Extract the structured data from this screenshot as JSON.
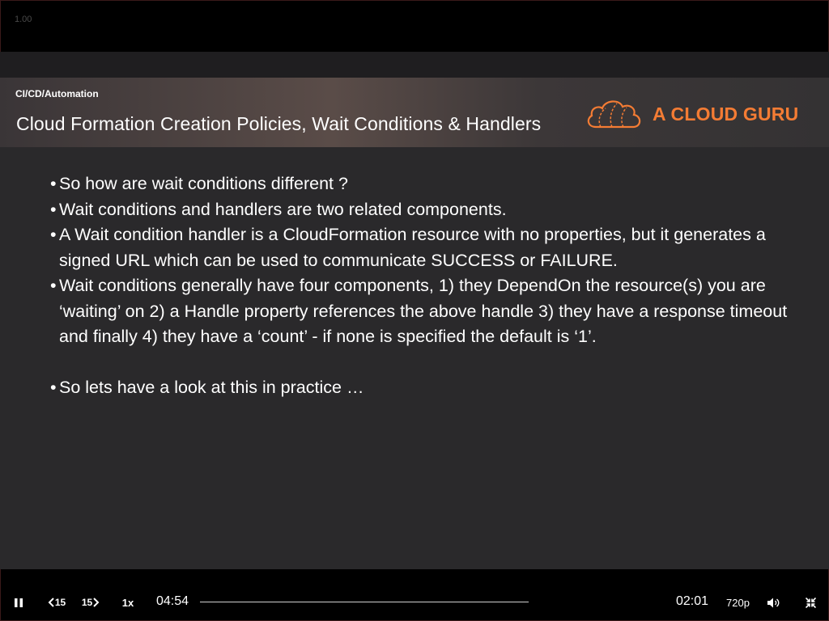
{
  "player": {
    "zoom": "1.00",
    "elapsed": "04:54",
    "remaining": "02:01",
    "speed": "1x",
    "rewind_label": "15",
    "forward_label": "15",
    "quality": "720p",
    "progress_fraction": 0.0
  },
  "slide": {
    "breadcrumb": "CI/CD/Automation",
    "title": "Cloud Formation Creation Policies, Wait Conditions & Handlers",
    "logo_text": "A CLOUD GURU",
    "bullets": [
      "So how are wait conditions different ?",
      "Wait conditions and handlers are two related components.",
      "A Wait condition handler is a CloudFormation resource with no properties, but it generates a signed URL which can be used to communicate SUCCESS or FAILURE.",
      "Wait conditions generally have four components, 1) they DependOn the resource(s) you are ‘waiting’ on 2) a Handle property references the above handle 3) they have a response timeout and finally 4) they have a ‘count’ - if none is specified the default is ‘1’.",
      "So lets have a look at this in practice …"
    ]
  },
  "colors": {
    "brand_orange": "#f47c34",
    "slide_bg": "#2a292b",
    "player_bg": "#000000"
  },
  "icons": {
    "pause": "pause-icon",
    "rewind": "rewind-15-icon",
    "forward": "forward-15-icon",
    "volume": "volume-icon",
    "exit_fullscreen": "exit-fullscreen-icon"
  }
}
